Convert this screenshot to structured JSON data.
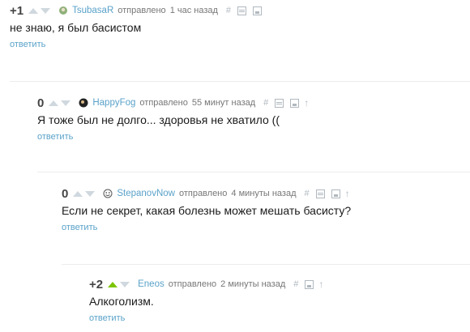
{
  "comments": [
    {
      "rating": "+1",
      "author": "TsubasaR",
      "posted": "отправлено",
      "time": "1 час назад",
      "hash": "#",
      "text": "не знаю, я был басистом",
      "reply": "ответить"
    },
    {
      "rating": "0",
      "author": "HappyFog",
      "posted": "отправлено",
      "time": "55 минут назад",
      "hash": "#",
      "text": "Я тоже был не долго... здоровья не хватило ((",
      "reply": "ответить"
    },
    {
      "rating": "0",
      "author": "StepanovNow",
      "posted": "отправлено",
      "time": "4 минуты назад",
      "hash": "#",
      "text": "Если не секрет, какая болезнь может мешать басисту?",
      "reply": "ответить"
    },
    {
      "rating": "+2",
      "author": "Eneos",
      "posted": "отправлено",
      "time": "2 минуты назад",
      "hash": "#",
      "text": "Алкоголизм.",
      "reply": "ответить"
    }
  ],
  "colors": {
    "link": "#5aa2c9",
    "upvote_active": "#7cc400",
    "icon": "#b0b8bf"
  }
}
